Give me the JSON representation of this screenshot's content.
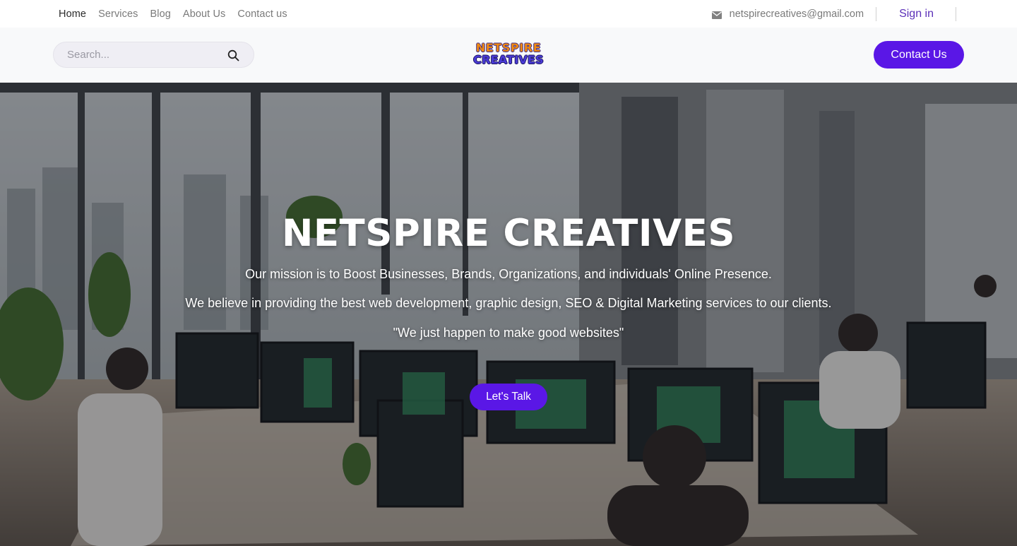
{
  "topbar": {
    "nav": [
      {
        "label": "Home",
        "active": true
      },
      {
        "label": "Services",
        "active": false
      },
      {
        "label": "Blog",
        "active": false
      },
      {
        "label": "About Us",
        "active": false
      },
      {
        "label": "Contact us",
        "active": false
      }
    ],
    "email": "netspirecreatives@gmail.com",
    "email_icon": "envelope-icon",
    "signin_label": "Sign in"
  },
  "header": {
    "search": {
      "placeholder": "Search...",
      "value": "",
      "icon": "search-icon"
    },
    "logo": {
      "line1": "NETSPIRE",
      "line2": "CREATIVES"
    },
    "contact_label": "Contact Us"
  },
  "hero": {
    "title": "NETSPIRE CREATIVES",
    "line1": "Our mission is to Boost Businesses, Brands, Organizations, and individuals' Online Presence.",
    "line2": "We believe in providing the best web development, graphic design, SEO & Digital Marketing services to our clients.",
    "line3": "\"We just happen to make good websites\"",
    "cta_label": "Let's Talk"
  },
  "colors": {
    "accent": "#5a17e6",
    "signin": "#5b2fb8",
    "logo_orange": "#f08a12",
    "logo_blue": "#4a3bd6",
    "header_bg": "#f8f9fa"
  }
}
